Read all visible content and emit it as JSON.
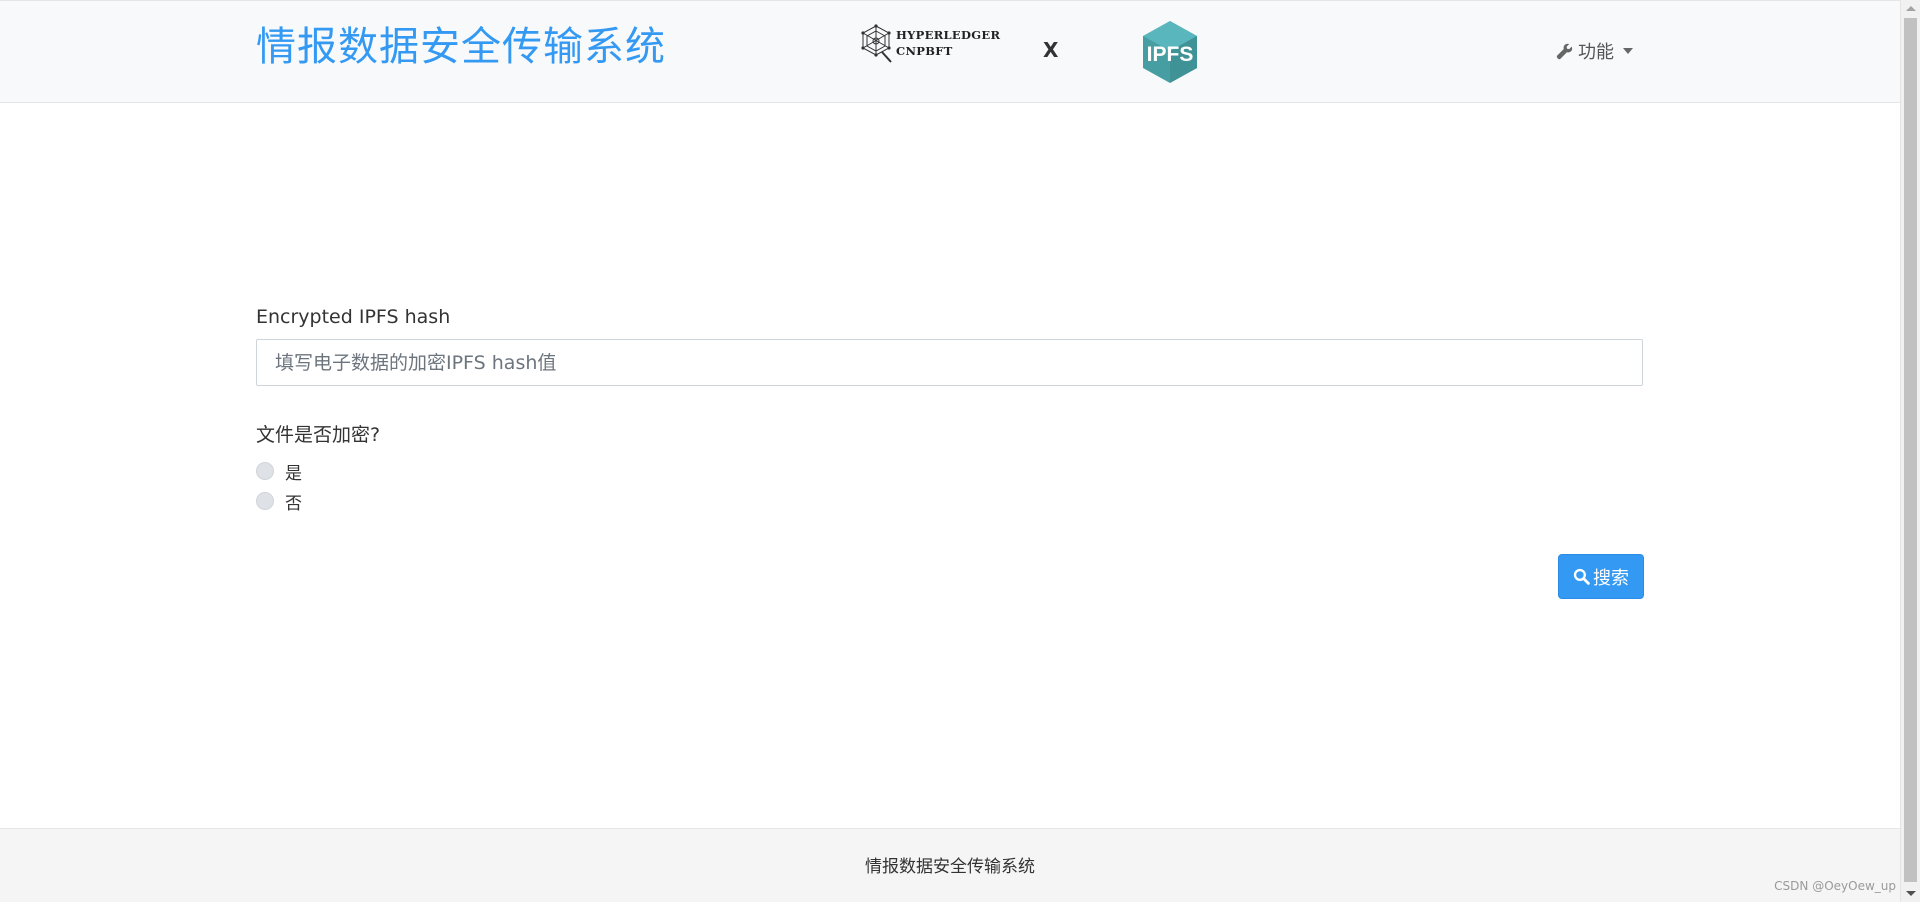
{
  "navbar": {
    "brand": "情报数据安全传输系统",
    "partner_logo": {
      "line1": "HYPERLEDGER",
      "line2": "CNPBFT"
    },
    "separator": "X",
    "ipfs_logo_text": "IPFS",
    "menu": {
      "icon": "wrench-icon",
      "label": "功能"
    }
  },
  "form": {
    "hash_label": "Encrypted IPFS hash",
    "hash_placeholder": "填写电子数据的加密IPFS hash值",
    "hash_value": "",
    "encrypt_question": "文件是否加密?",
    "options": [
      {
        "label": "是",
        "checked": false
      },
      {
        "label": "否",
        "checked": false
      }
    ],
    "search_button": {
      "icon": "search-icon",
      "label": "搜索"
    }
  },
  "footer": {
    "text": "情报数据安全传输系统"
  },
  "watermark": "CSDN @OeyOew_up",
  "colors": {
    "brand": "#3399f3",
    "button": "#3399f3",
    "ipfs": "#469ea2"
  }
}
